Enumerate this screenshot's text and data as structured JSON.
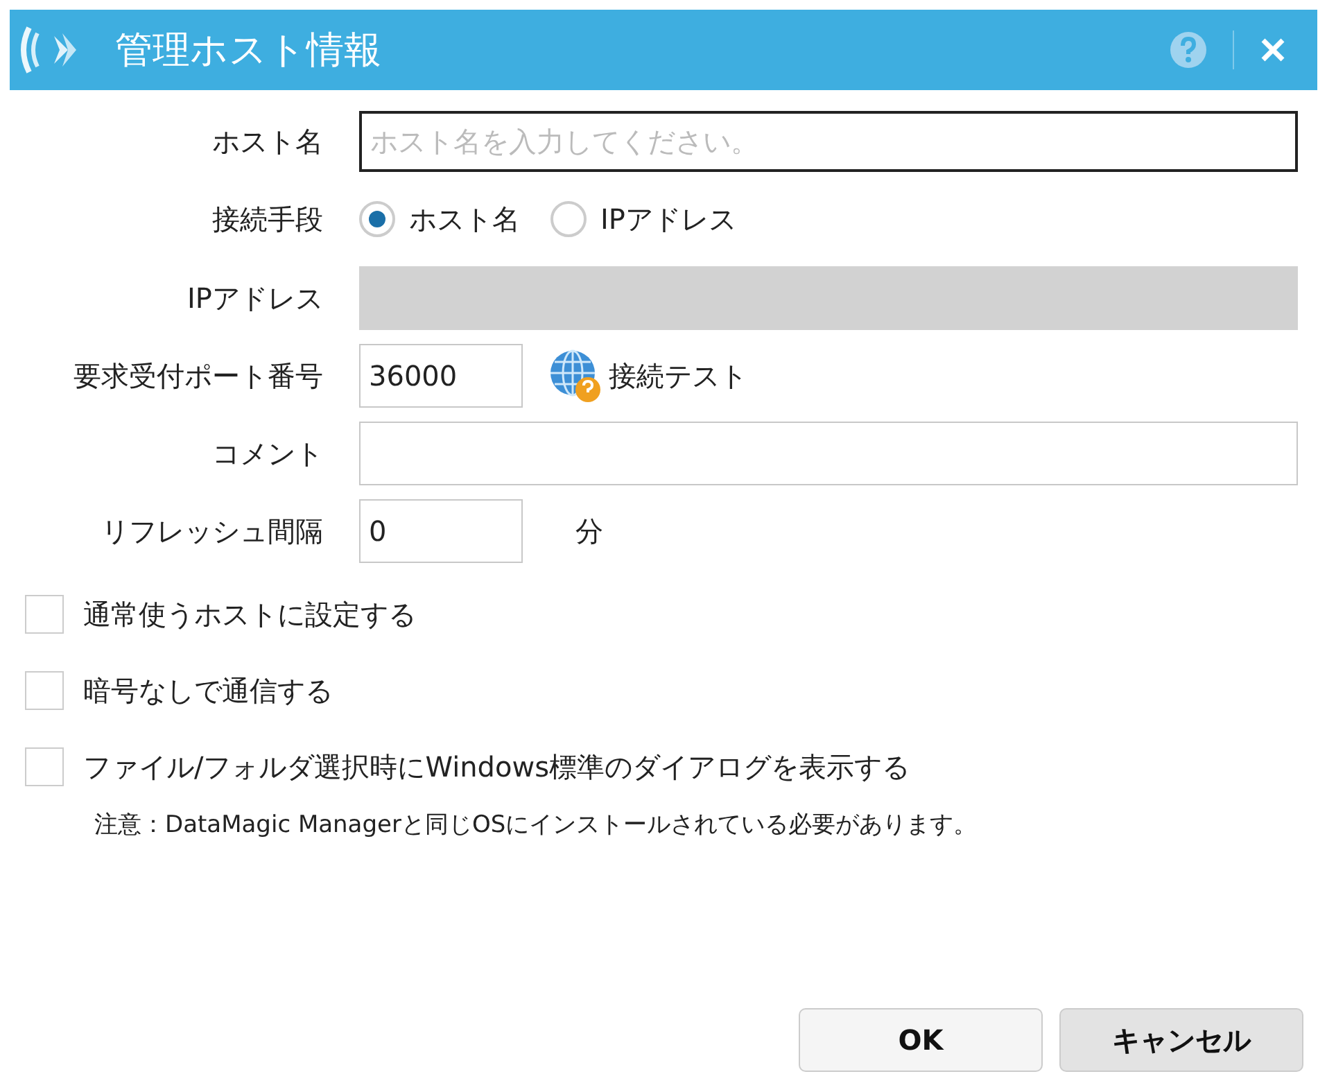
{
  "window": {
    "title": "管理ホスト情報"
  },
  "host_name": {
    "label": "ホスト名",
    "placeholder": "ホスト名を入力してください。"
  },
  "connection": {
    "label": "接続手段",
    "options": [
      {
        "label": "ホスト名",
        "selected": true
      },
      {
        "label": "IPアドレス",
        "selected": false
      }
    ]
  },
  "ip_address": {
    "label": "IPアドレス",
    "disabled": true
  },
  "port": {
    "label": "要求受付ポート番号",
    "value": "36000",
    "test_button": "接続テスト"
  },
  "comment": {
    "label": "コメント"
  },
  "refresh": {
    "label": "リフレッシュ間隔",
    "value": "0",
    "unit": "分"
  },
  "checkboxes": [
    {
      "label": "通常使うホストに設定する",
      "checked": false
    },
    {
      "label": "暗号なしで通信する",
      "checked": false
    },
    {
      "label": "ファイル/フォルダ選択時にWindows標準のダイアログを表示する",
      "checked": false
    }
  ],
  "note": "注意：DataMagic Managerと同じOSにインストールされている必要があります。",
  "buttons": [
    {
      "label": "OK",
      "kind": "primary"
    },
    {
      "label": "キャンセル",
      "kind": "secondary"
    }
  ]
}
